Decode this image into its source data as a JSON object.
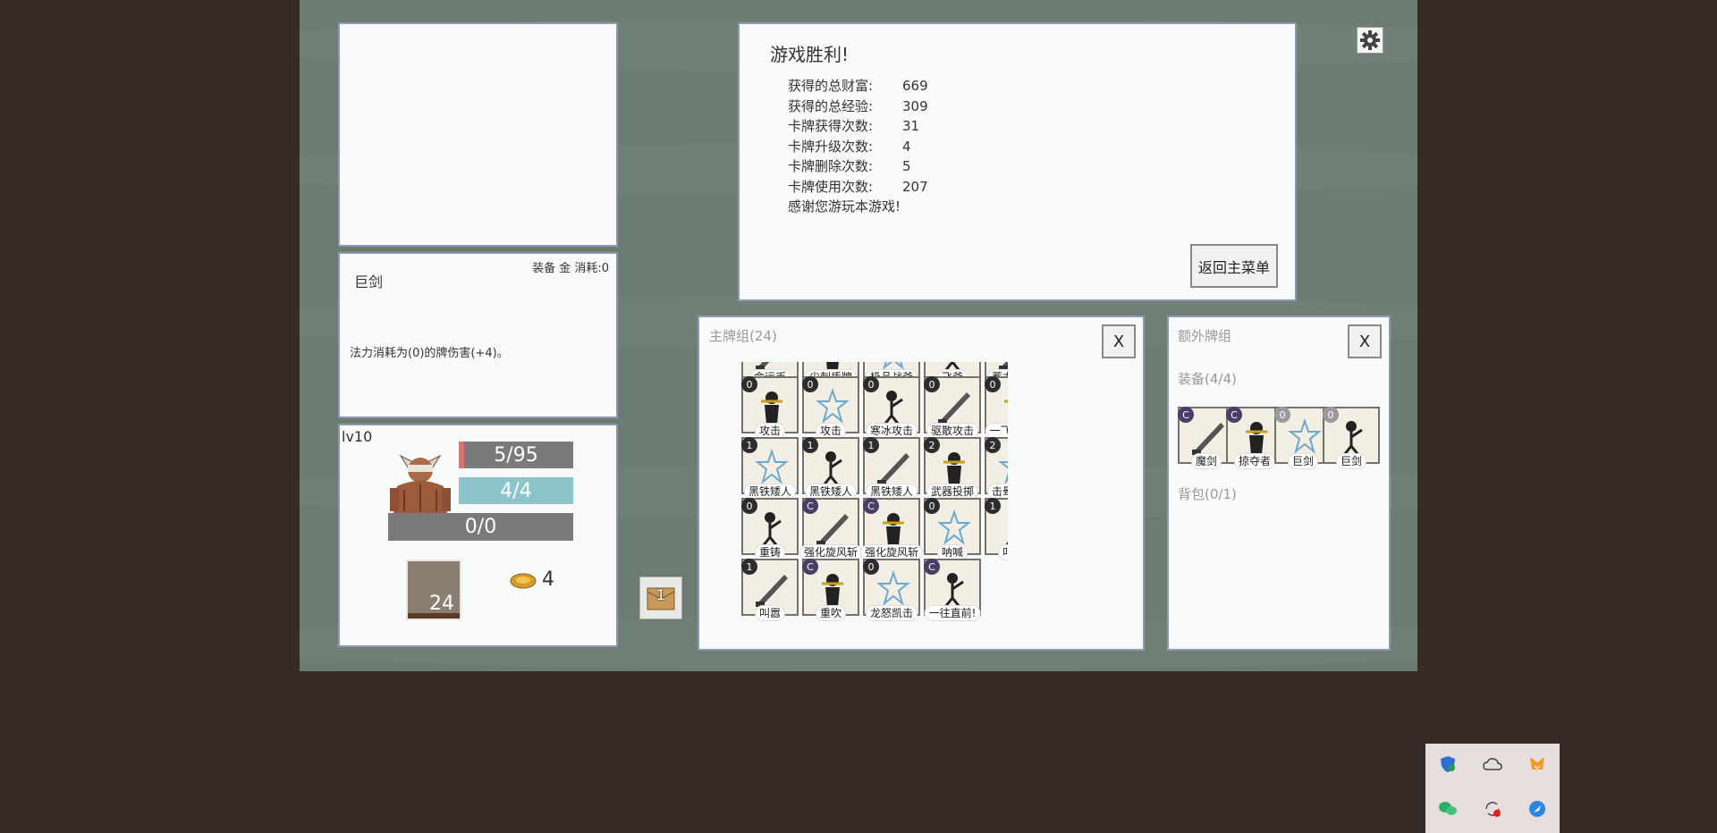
{
  "victory": {
    "title": "游戏胜利!",
    "stats": [
      {
        "label": "获得的总财富:",
        "value": "669"
      },
      {
        "label": "获得的总经验:",
        "value": "309"
      },
      {
        "label": "卡牌获得次数:",
        "value": "31"
      },
      {
        "label": "卡牌升级次数:",
        "value": "4"
      },
      {
        "label": "卡牌删除次数:",
        "value": "5"
      },
      {
        "label": "卡牌使用次数:",
        "value": "207"
      }
    ],
    "thanks": "感谢您游玩本游戏!",
    "menu_button": "返回主菜单"
  },
  "card_detail": {
    "meta": "装备 金 消耗:0",
    "name": "巨剑",
    "description": "法力消耗为(0)的牌伤害(+4)。"
  },
  "player": {
    "level": "lv10",
    "hp": "5/95",
    "hp_fraction": 0.05,
    "mana": "4/4",
    "mana_fraction": 1.0,
    "shield": "0/0",
    "deck_count": "24",
    "gold": "4"
  },
  "chest_badge": "1",
  "main_deck": {
    "title": "主牌组(24)",
    "close": "X",
    "rows": [
      [
        {
          "cost": "",
          "name": "命运币"
        },
        {
          "cost": "",
          "name": "尖刺盾牌"
        },
        {
          "cost": "",
          "name": "极品战斧"
        },
        {
          "cost": "",
          "name": "飞斧"
        },
        {
          "cost": "",
          "name": "蓄力强击"
        }
      ],
      [
        {
          "cost": "0",
          "name": "攻击"
        },
        {
          "cost": "0",
          "name": "攻击"
        },
        {
          "cost": "0",
          "name": "寒冰攻击"
        },
        {
          "cost": "0",
          "name": "驱散攻击"
        },
        {
          "cost": "0",
          "name": "一飞冲天!"
        }
      ],
      [
        {
          "cost": "1",
          "name": "黑铁矮人"
        },
        {
          "cost": "1",
          "name": "黑铁矮人"
        },
        {
          "cost": "1",
          "name": "黑铁矮人"
        },
        {
          "cost": "2",
          "name": "武器投掷"
        },
        {
          "cost": "2",
          "name": "击晕投掷"
        }
      ],
      [
        {
          "cost": "0",
          "name": "重铸"
        },
        {
          "cost": "C",
          "name": "强化旋风斩"
        },
        {
          "cost": "C",
          "name": "强化旋风斩"
        },
        {
          "cost": "0",
          "name": "呐喊"
        },
        {
          "cost": "1",
          "name": "叫嚣"
        }
      ],
      [
        {
          "cost": "1",
          "name": "叫嚣"
        },
        {
          "cost": "C",
          "name": "重吹"
        },
        {
          "cost": "0",
          "name": "龙怒凯击"
        },
        {
          "cost": "C",
          "name": "一往直前!"
        }
      ]
    ]
  },
  "extra_deck": {
    "title": "额外牌组",
    "close": "X",
    "equipment_label": "装备(4/4)",
    "equipment": [
      {
        "cost": "C",
        "name": "魔剑"
      },
      {
        "cost": "C",
        "name": "掠夺者"
      },
      {
        "cost": "0",
        "name": "巨剑"
      },
      {
        "cost": "0",
        "name": "巨剑"
      }
    ],
    "backpack_label": "背包(0/1)"
  },
  "colors": {
    "background": "#362b27",
    "table": "#6c7c72",
    "panel_border": "#8d97b3",
    "hp_bar": "#7a7a7a",
    "mana_bar": "#8cc4cc",
    "hp_accent": "#e07070"
  },
  "tray_icons": [
    "shield-check-icon",
    "cloud-icon",
    "fox-icon",
    "wechat-icon",
    "sync-record-icon",
    "feather-icon"
  ]
}
